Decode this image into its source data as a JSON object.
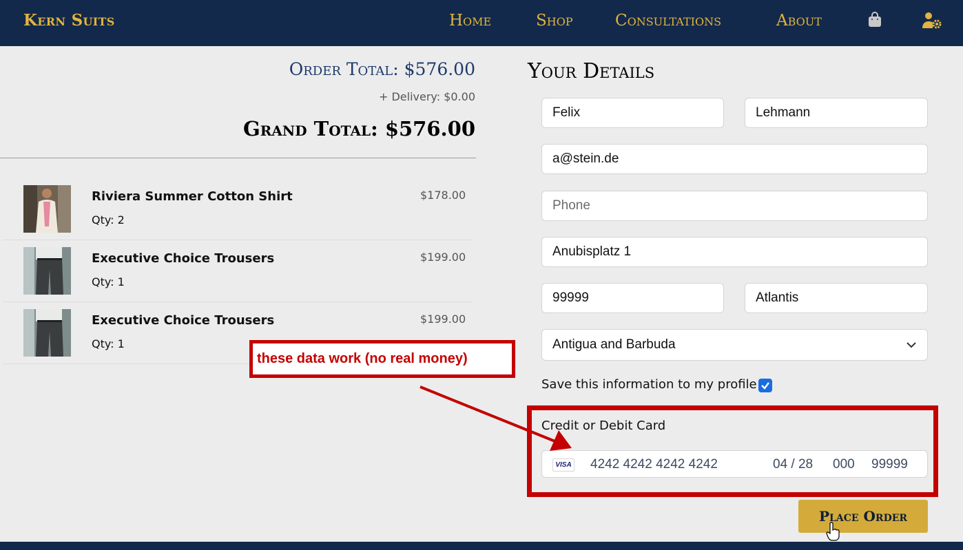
{
  "header": {
    "brand": "Kern Suits",
    "nav": {
      "home": "Home",
      "shop": "Shop",
      "consultations": "Consultations",
      "about": "About"
    },
    "icons": [
      "shopping-bag-icon",
      "user-gear-icon"
    ]
  },
  "summary": {
    "order_total": "Order Total: $576.00",
    "delivery": "+ Delivery: $0.00",
    "grand_total": "Grand Total: $576.00"
  },
  "items": [
    {
      "name": "Riviera Summer Cotton Shirt",
      "qty": "Qty: 2",
      "price": "$178.00"
    },
    {
      "name": "Executive Choice Trousers",
      "qty": "Qty: 1",
      "price": "$199.00"
    },
    {
      "name": "Executive Choice Trousers",
      "qty": "Qty: 1",
      "price": "$199.00"
    }
  ],
  "details": {
    "title": "Your Details",
    "first_name": "Felix",
    "last_name": "Lehmann",
    "email": "a@stein.de",
    "phone_placeholder": "Phone",
    "address": "Anubisplatz 1",
    "zip": "99999",
    "city": "Atlantis",
    "country": "Antigua and Barbuda",
    "save_label": "Save this information to my profile",
    "save_checked": true
  },
  "payment": {
    "label": "Credit or Debit Card",
    "brand": "VISA",
    "number": "4242 4242 4242 4242",
    "expiry": "04 / 28",
    "cvc": "000",
    "postal": "99999"
  },
  "actions": {
    "place_order": "Place Order"
  },
  "annotation": {
    "text": "these data work (no real money)",
    "color": "#c40000"
  },
  "colors": {
    "navy": "#13294b",
    "gold": "#e0b43e",
    "button": "#d4ab3a",
    "background": "#ececec"
  }
}
